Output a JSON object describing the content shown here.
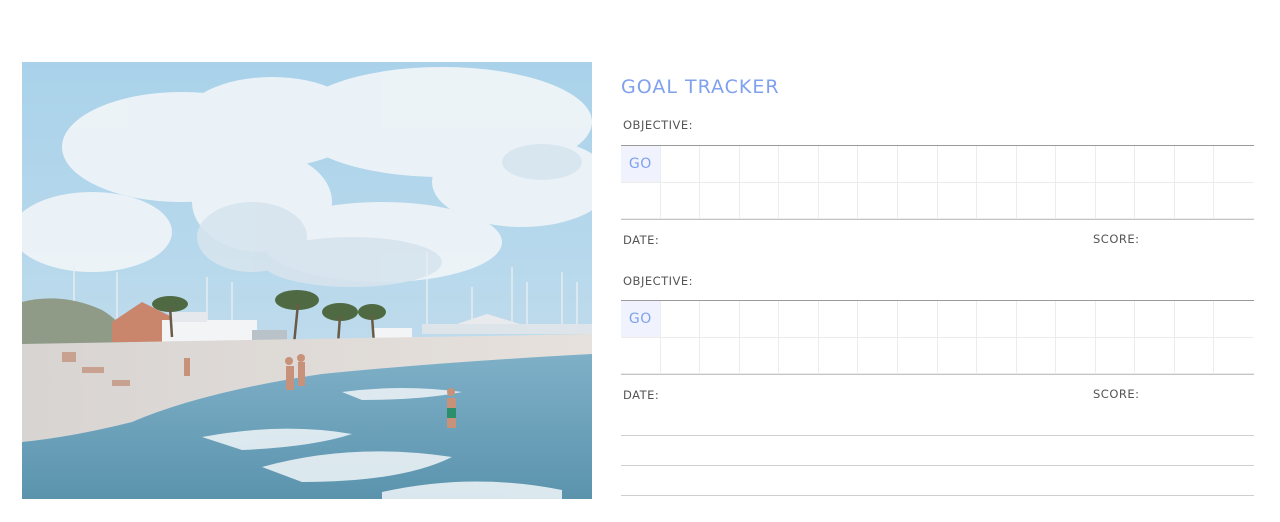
{
  "tracker": {
    "title": "GOAL TRACKER",
    "blocks": [
      {
        "objective_label": "OBJECTIVE:",
        "go_label": "GO",
        "date_label": "DATE:",
        "score_label": "SCORE:"
      },
      {
        "objective_label": "OBJECTIVE:",
        "go_label": "GO",
        "date_label": "DATE:",
        "score_label": "SCORE:"
      }
    ]
  },
  "photo": {
    "subject": "beach scene",
    "accent_color": "#7fa1ee"
  }
}
